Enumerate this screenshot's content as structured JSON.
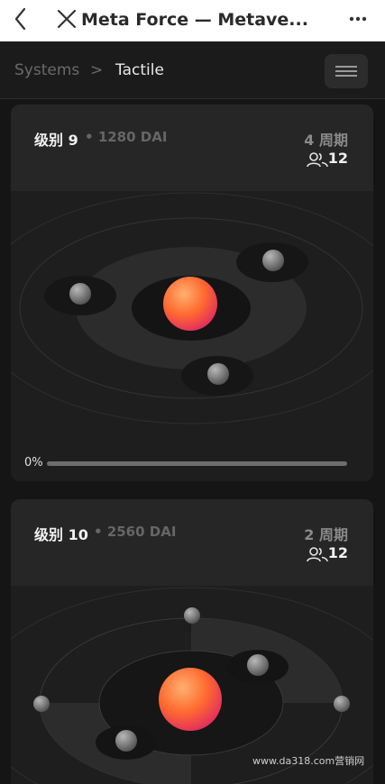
{
  "header": {
    "title": "Meta Force — Metave...",
    "back_icon": "chevron-left-icon",
    "close_icon": "close-icon",
    "more_icon": "more-horizontal-icon"
  },
  "breadcrumb": {
    "parent": "Systems",
    "separator": ">",
    "current": "Tactile",
    "menu_icon": "hamburger-menu-icon"
  },
  "levels": [
    {
      "level_label": "级别 9",
      "price": "1280 DAI",
      "cycles": "4 周期",
      "participants": "12",
      "progress_label": "0%",
      "progress": 0
    },
    {
      "level_label": "级别 10",
      "price": "2560 DAI",
      "cycles": "2 周期",
      "participants": "12"
    }
  ],
  "watermark": "www.da318.com营销网",
  "colors": {
    "background": "#151515",
    "card": "#1e1e1e",
    "header_bar": "#ffffff",
    "accent_orb": "#ff7a3c"
  }
}
